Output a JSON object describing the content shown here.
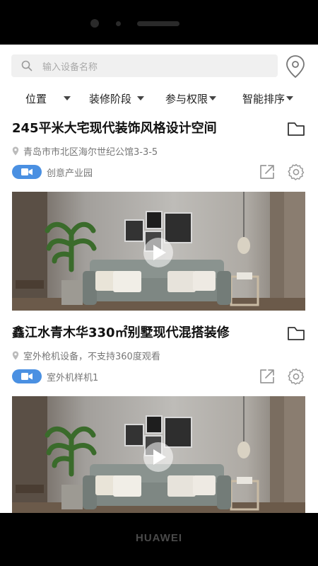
{
  "device": {
    "brand": "HUAWEI"
  },
  "search": {
    "placeholder": "输入设备名称",
    "location_icon": "map-pin-icon"
  },
  "filters": [
    {
      "label": "位置"
    },
    {
      "label": "装修阶段"
    },
    {
      "label": "参与权限"
    },
    {
      "label": "智能排序"
    }
  ],
  "cards": [
    {
      "title": "245平米大宅现代装饰风格设计空间",
      "address": "青岛市市北区海尔世纪公馆3-3-5",
      "tag": "创意产业园"
    },
    {
      "title": "鑫江水青木华330㎡别墅现代混搭装修",
      "address": "室外枪机设备，不支持360度观看",
      "tag": "室外机样机1"
    }
  ],
  "colors": {
    "accent": "#4a90e2",
    "text": "#111111",
    "muted": "#777777"
  }
}
